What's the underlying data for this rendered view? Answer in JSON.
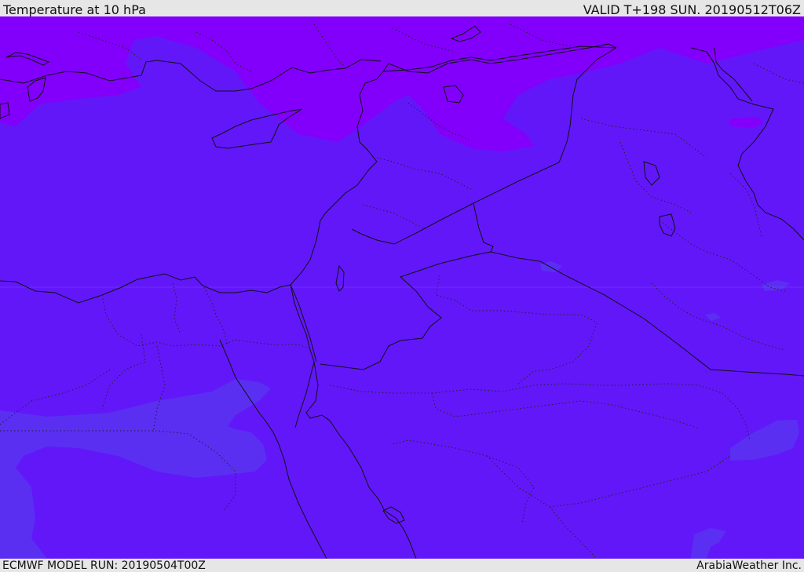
{
  "header": {
    "title": "Temperature at 10 hPa",
    "valid": "VALID T+198 SUN. 20190512T06Z"
  },
  "footer": {
    "model_run": "ECMWF MODEL RUN: 20190504T00Z",
    "credit": "ArabiaWeather Inc."
  },
  "colors": {
    "field_base": "#6217f9",
    "field_warm": "#8200fb",
    "field_cool": "#5a2ff2",
    "border": "#111111",
    "bar_background": "#e6e6e6"
  }
}
